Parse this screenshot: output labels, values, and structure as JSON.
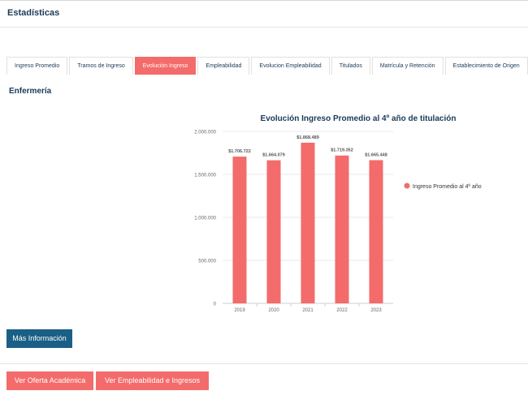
{
  "header": {
    "title": "Estadísticas"
  },
  "tabs": [
    {
      "label": "Ingreso Promedio",
      "active": false
    },
    {
      "label": "Tramos de Ingreso",
      "active": false
    },
    {
      "label": "Evolución Ingreso",
      "active": true
    },
    {
      "label": "Empleabilidad",
      "active": false
    },
    {
      "label": "Evolucion Empleabilidad",
      "active": false
    },
    {
      "label": "Titulados",
      "active": false
    },
    {
      "label": "Matrícula y Retención",
      "active": false
    },
    {
      "label": "Establecimiento de Origen",
      "active": false
    }
  ],
  "section": {
    "title": "Enfermería"
  },
  "chart_data": {
    "type": "bar",
    "title": "Evolución Ingreso Promedio al 4º año de titulación",
    "categories": [
      "2019",
      "2020",
      "2021",
      "2022",
      "2023"
    ],
    "series": [
      {
        "name": "Ingreso Promedio al 4º año",
        "values": [
          1706722,
          1664079,
          1868489,
          1719352,
          1665448
        ],
        "data_labels": [
          "$1.706.722",
          "$1.664.079",
          "$1.868.489",
          "$1.719.352",
          "$1.665.448"
        ],
        "color": "#f36b6b"
      }
    ],
    "y_ticks": [
      0,
      500000,
      1000000,
      1500000,
      2000000
    ],
    "y_tick_labels": [
      "0",
      "500.000",
      "1.000.000",
      "1.500.000",
      "2.000.000"
    ],
    "ylim": [
      0,
      2000000
    ],
    "xlabel": "",
    "ylabel": "",
    "grid": true,
    "legend_position": "right"
  },
  "buttons": {
    "mas_info": "Más Información",
    "oferta": "Ver Oferta Académica",
    "empleabilidad": "Ver Empleabilidad e Ingresos"
  },
  "colors": {
    "accent": "#f36b6b",
    "primary": "#1a5f85",
    "heading": "#1b3a57"
  }
}
